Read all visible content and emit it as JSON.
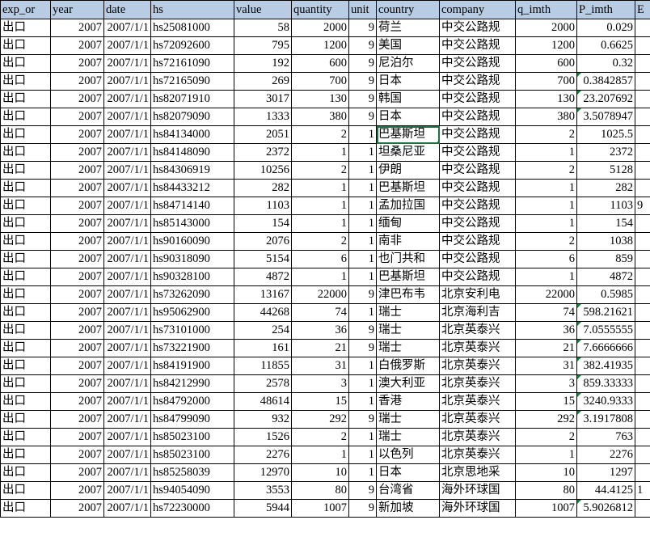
{
  "sheet": {
    "selected_cell_value": "巴基斯坦",
    "accent_header_bg": "#b8cce4",
    "selection_color": "#1e7145",
    "error_marker_color": "#1f7a3f"
  },
  "columns": [
    {
      "key": "exp_or",
      "label": "exp_or",
      "align": "txt"
    },
    {
      "key": "year",
      "label": "year",
      "align": "num"
    },
    {
      "key": "date",
      "label": "date",
      "align": "num"
    },
    {
      "key": "hs",
      "label": "hs",
      "align": "txt"
    },
    {
      "key": "value",
      "label": "value",
      "align": "num"
    },
    {
      "key": "quantity",
      "label": "quantity",
      "align": "num"
    },
    {
      "key": "unit",
      "label": "unit",
      "align": "num"
    },
    {
      "key": "country",
      "label": "country",
      "align": "txt"
    },
    {
      "key": "company",
      "label": "company",
      "align": "txt"
    },
    {
      "key": "q_imth",
      "label": "q_imth",
      "align": "num"
    },
    {
      "key": "P_imth",
      "label": "P_imth",
      "align": "num"
    },
    {
      "key": "extra",
      "label": "E",
      "align": "txt"
    }
  ],
  "rows": [
    {
      "exp_or": "出口",
      "year": "2007",
      "date": "2007/1/1",
      "hs": "hs25081000",
      "value": "58",
      "quantity": "2000",
      "unit": "9",
      "country": "荷兰",
      "company": "中交公路规",
      "q_imth": "2000",
      "P_imth": "0.029",
      "P_err": false,
      "extra": "",
      "sel": false
    },
    {
      "exp_or": "出口",
      "year": "2007",
      "date": "2007/1/1",
      "hs": "hs72092600",
      "value": "795",
      "quantity": "1200",
      "unit": "9",
      "country": "美国",
      "company": "中交公路规",
      "q_imth": "1200",
      "P_imth": "0.6625",
      "P_err": false,
      "extra": "",
      "sel": false
    },
    {
      "exp_or": "出口",
      "year": "2007",
      "date": "2007/1/1",
      "hs": "hs72161090",
      "value": "192",
      "quantity": "600",
      "unit": "9",
      "country": "尼泊尔",
      "company": "中交公路规",
      "q_imth": "600",
      "P_imth": "0.32",
      "P_err": false,
      "extra": "",
      "sel": false
    },
    {
      "exp_or": "出口",
      "year": "2007",
      "date": "2007/1/1",
      "hs": "hs72165090",
      "value": "269",
      "quantity": "700",
      "unit": "9",
      "country": "日本",
      "company": "中交公路规",
      "q_imth": "700",
      "P_imth": "0.3842857",
      "P_err": true,
      "extra": "",
      "sel": false
    },
    {
      "exp_or": "出口",
      "year": "2007",
      "date": "2007/1/1",
      "hs": "hs82071910",
      "value": "3017",
      "quantity": "130",
      "unit": "9",
      "country": "韩国",
      "company": "中交公路规",
      "q_imth": "130",
      "P_imth": "23.207692",
      "P_err": true,
      "extra": "",
      "sel": false
    },
    {
      "exp_or": "出口",
      "year": "2007",
      "date": "2007/1/1",
      "hs": "hs82079090",
      "value": "1333",
      "quantity": "380",
      "unit": "9",
      "country": "日本",
      "company": "中交公路规",
      "q_imth": "380",
      "P_imth": "3.5078947",
      "P_err": true,
      "extra": "",
      "sel": false
    },
    {
      "exp_or": "出口",
      "year": "2007",
      "date": "2007/1/1",
      "hs": "hs84134000",
      "value": "2051",
      "quantity": "2",
      "unit": "1",
      "country": "巴基斯坦",
      "company": "中交公路规",
      "q_imth": "2",
      "P_imth": "1025.5",
      "P_err": false,
      "extra": "",
      "sel": true
    },
    {
      "exp_or": "出口",
      "year": "2007",
      "date": "2007/1/1",
      "hs": "hs84148090",
      "value": "2372",
      "quantity": "1",
      "unit": "1",
      "country": "坦桑尼亚",
      "company": "中交公路规",
      "q_imth": "1",
      "P_imth": "2372",
      "P_err": false,
      "extra": "",
      "sel": false
    },
    {
      "exp_or": "出口",
      "year": "2007",
      "date": "2007/1/1",
      "hs": "hs84306919",
      "value": "10256",
      "quantity": "2",
      "unit": "1",
      "country": "伊朗",
      "company": "中交公路规",
      "q_imth": "2",
      "P_imth": "5128",
      "P_err": false,
      "extra": "",
      "sel": false
    },
    {
      "exp_or": "出口",
      "year": "2007",
      "date": "2007/1/1",
      "hs": "hs84433212",
      "value": "282",
      "quantity": "1",
      "unit": "1",
      "country": "巴基斯坦",
      "company": "中交公路规",
      "q_imth": "1",
      "P_imth": "282",
      "P_err": false,
      "extra": "",
      "sel": false
    },
    {
      "exp_or": "出口",
      "year": "2007",
      "date": "2007/1/1",
      "hs": "hs84714140",
      "value": "1103",
      "quantity": "1",
      "unit": "1",
      "country": "孟加拉国",
      "company": "中交公路规",
      "q_imth": "1",
      "P_imth": "1103",
      "P_err": false,
      "extra": "9",
      "sel": false
    },
    {
      "exp_or": "出口",
      "year": "2007",
      "date": "2007/1/1",
      "hs": "hs85143000",
      "value": "154",
      "quantity": "1",
      "unit": "1",
      "country": "缅甸",
      "company": "中交公路规",
      "q_imth": "1",
      "P_imth": "154",
      "P_err": false,
      "extra": "",
      "sel": false
    },
    {
      "exp_or": "出口",
      "year": "2007",
      "date": "2007/1/1",
      "hs": "hs90160090",
      "value": "2076",
      "quantity": "2",
      "unit": "1",
      "country": "南非",
      "company": "中交公路规",
      "q_imth": "2",
      "P_imth": "1038",
      "P_err": false,
      "extra": "",
      "sel": false
    },
    {
      "exp_or": "出口",
      "year": "2007",
      "date": "2007/1/1",
      "hs": "hs90318090",
      "value": "5154",
      "quantity": "6",
      "unit": "1",
      "country": "也门共和",
      "company": "中交公路规",
      "q_imth": "6",
      "P_imth": "859",
      "P_err": false,
      "extra": "",
      "sel": false
    },
    {
      "exp_or": "出口",
      "year": "2007",
      "date": "2007/1/1",
      "hs": "hs90328100",
      "value": "4872",
      "quantity": "1",
      "unit": "1",
      "country": "巴基斯坦",
      "company": "中交公路规",
      "q_imth": "1",
      "P_imth": "4872",
      "P_err": false,
      "extra": "",
      "sel": false
    },
    {
      "exp_or": "出口",
      "year": "2007",
      "date": "2007/1/1",
      "hs": "hs73262090",
      "value": "13167",
      "quantity": "22000",
      "unit": "9",
      "country": "津巴布韦",
      "company": "北京安利电",
      "q_imth": "22000",
      "P_imth": "0.5985",
      "P_err": false,
      "extra": "",
      "sel": false
    },
    {
      "exp_or": "出口",
      "year": "2007",
      "date": "2007/1/1",
      "hs": "hs95062900",
      "value": "44268",
      "quantity": "74",
      "unit": "1",
      "country": "瑞士",
      "company": "北京海利吉",
      "q_imth": "74",
      "P_imth": "598.21621",
      "P_err": true,
      "extra": "",
      "sel": false
    },
    {
      "exp_or": "出口",
      "year": "2007",
      "date": "2007/1/1",
      "hs": "hs73101000",
      "value": "254",
      "quantity": "36",
      "unit": "9",
      "country": "瑞士",
      "company": "北京英泰兴",
      "q_imth": "36",
      "P_imth": "7.0555555",
      "P_err": true,
      "extra": "",
      "sel": false
    },
    {
      "exp_or": "出口",
      "year": "2007",
      "date": "2007/1/1",
      "hs": "hs73221900",
      "value": "161",
      "quantity": "21",
      "unit": "9",
      "country": "瑞士",
      "company": "北京英泰兴",
      "q_imth": "21",
      "P_imth": "7.6666666",
      "P_err": true,
      "extra": "",
      "sel": false
    },
    {
      "exp_or": "出口",
      "year": "2007",
      "date": "2007/1/1",
      "hs": "hs84191900",
      "value": "11855",
      "quantity": "31",
      "unit": "1",
      "country": "白俄罗斯",
      "company": "北京英泰兴",
      "q_imth": "31",
      "P_imth": "382.41935",
      "P_err": true,
      "extra": "",
      "sel": false
    },
    {
      "exp_or": "出口",
      "year": "2007",
      "date": "2007/1/1",
      "hs": "hs84212990",
      "value": "2578",
      "quantity": "3",
      "unit": "1",
      "country": "澳大利亚",
      "company": "北京英泰兴",
      "q_imth": "3",
      "P_imth": "859.33333",
      "P_err": true,
      "extra": "",
      "sel": false
    },
    {
      "exp_or": "出口",
      "year": "2007",
      "date": "2007/1/1",
      "hs": "hs84792000",
      "value": "48614",
      "quantity": "15",
      "unit": "1",
      "country": "香港",
      "company": "北京英泰兴",
      "q_imth": "15",
      "P_imth": "3240.9333",
      "P_err": true,
      "extra": "",
      "sel": false
    },
    {
      "exp_or": "出口",
      "year": "2007",
      "date": "2007/1/1",
      "hs": "hs84799090",
      "value": "932",
      "quantity": "292",
      "unit": "9",
      "country": "瑞士",
      "company": "北京英泰兴",
      "q_imth": "292",
      "P_imth": "3.1917808",
      "P_err": true,
      "extra": "",
      "sel": false
    },
    {
      "exp_or": "出口",
      "year": "2007",
      "date": "2007/1/1",
      "hs": "hs85023100",
      "value": "1526",
      "quantity": "2",
      "unit": "1",
      "country": "瑞士",
      "company": "北京英泰兴",
      "q_imth": "2",
      "P_imth": "763",
      "P_err": false,
      "extra": "",
      "sel": false
    },
    {
      "exp_or": "出口",
      "year": "2007",
      "date": "2007/1/1",
      "hs": "hs85023100",
      "value": "2276",
      "quantity": "1",
      "unit": "1",
      "country": "以色列",
      "company": "北京英泰兴",
      "q_imth": "1",
      "P_imth": "2276",
      "P_err": false,
      "extra": "",
      "sel": false
    },
    {
      "exp_or": "出口",
      "year": "2007",
      "date": "2007/1/1",
      "hs": "hs85258039",
      "value": "12970",
      "quantity": "10",
      "unit": "1",
      "country": "日本",
      "company": "北京思地采",
      "q_imth": "10",
      "P_imth": "1297",
      "P_err": false,
      "extra": "",
      "sel": false
    },
    {
      "exp_or": "出口",
      "year": "2007",
      "date": "2007/1/1",
      "hs": "hs94054090",
      "value": "3553",
      "quantity": "80",
      "unit": "9",
      "country": "台湾省",
      "company": "海外环球国",
      "q_imth": "80",
      "P_imth": "44.4125",
      "P_err": false,
      "extra": "1",
      "sel": false
    },
    {
      "exp_or": "出口",
      "year": "2007",
      "date": "2007/1/1",
      "hs": "hs72230000",
      "value": "5944",
      "quantity": "1007",
      "unit": "9",
      "country": "新加坡",
      "company": "海外环球国",
      "q_imth": "1007",
      "P_imth": "5.9026812",
      "P_err": true,
      "extra": "",
      "sel": false
    }
  ]
}
